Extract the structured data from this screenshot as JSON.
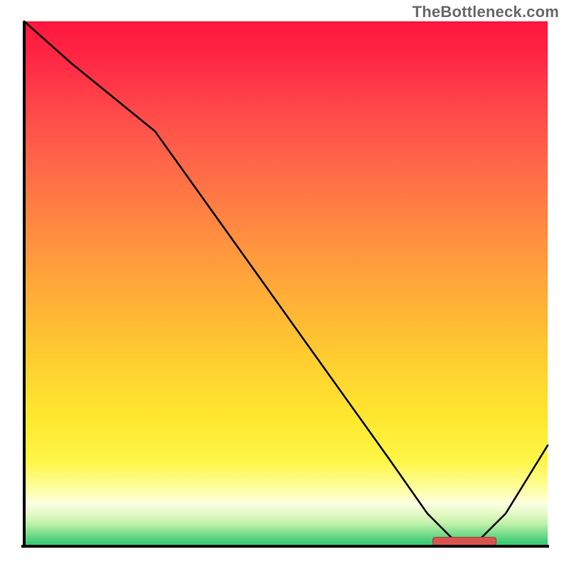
{
  "watermark": "TheBottleneck.com",
  "chart_data": {
    "type": "line",
    "title": "",
    "xlabel": "",
    "ylabel": "",
    "xlim": [
      0,
      100
    ],
    "ylim": [
      0,
      100
    ],
    "grid": false,
    "legend": false,
    "x": [
      0,
      9,
      25,
      40,
      55,
      70,
      77,
      82,
      87,
      92,
      100
    ],
    "y": [
      100,
      92,
      79,
      58,
      37,
      16,
      6,
      1,
      1,
      6,
      19
    ],
    "optimal_range_x": [
      78,
      90
    ],
    "optimal_range_y": 0.8,
    "marker_color": "#d9534f"
  }
}
